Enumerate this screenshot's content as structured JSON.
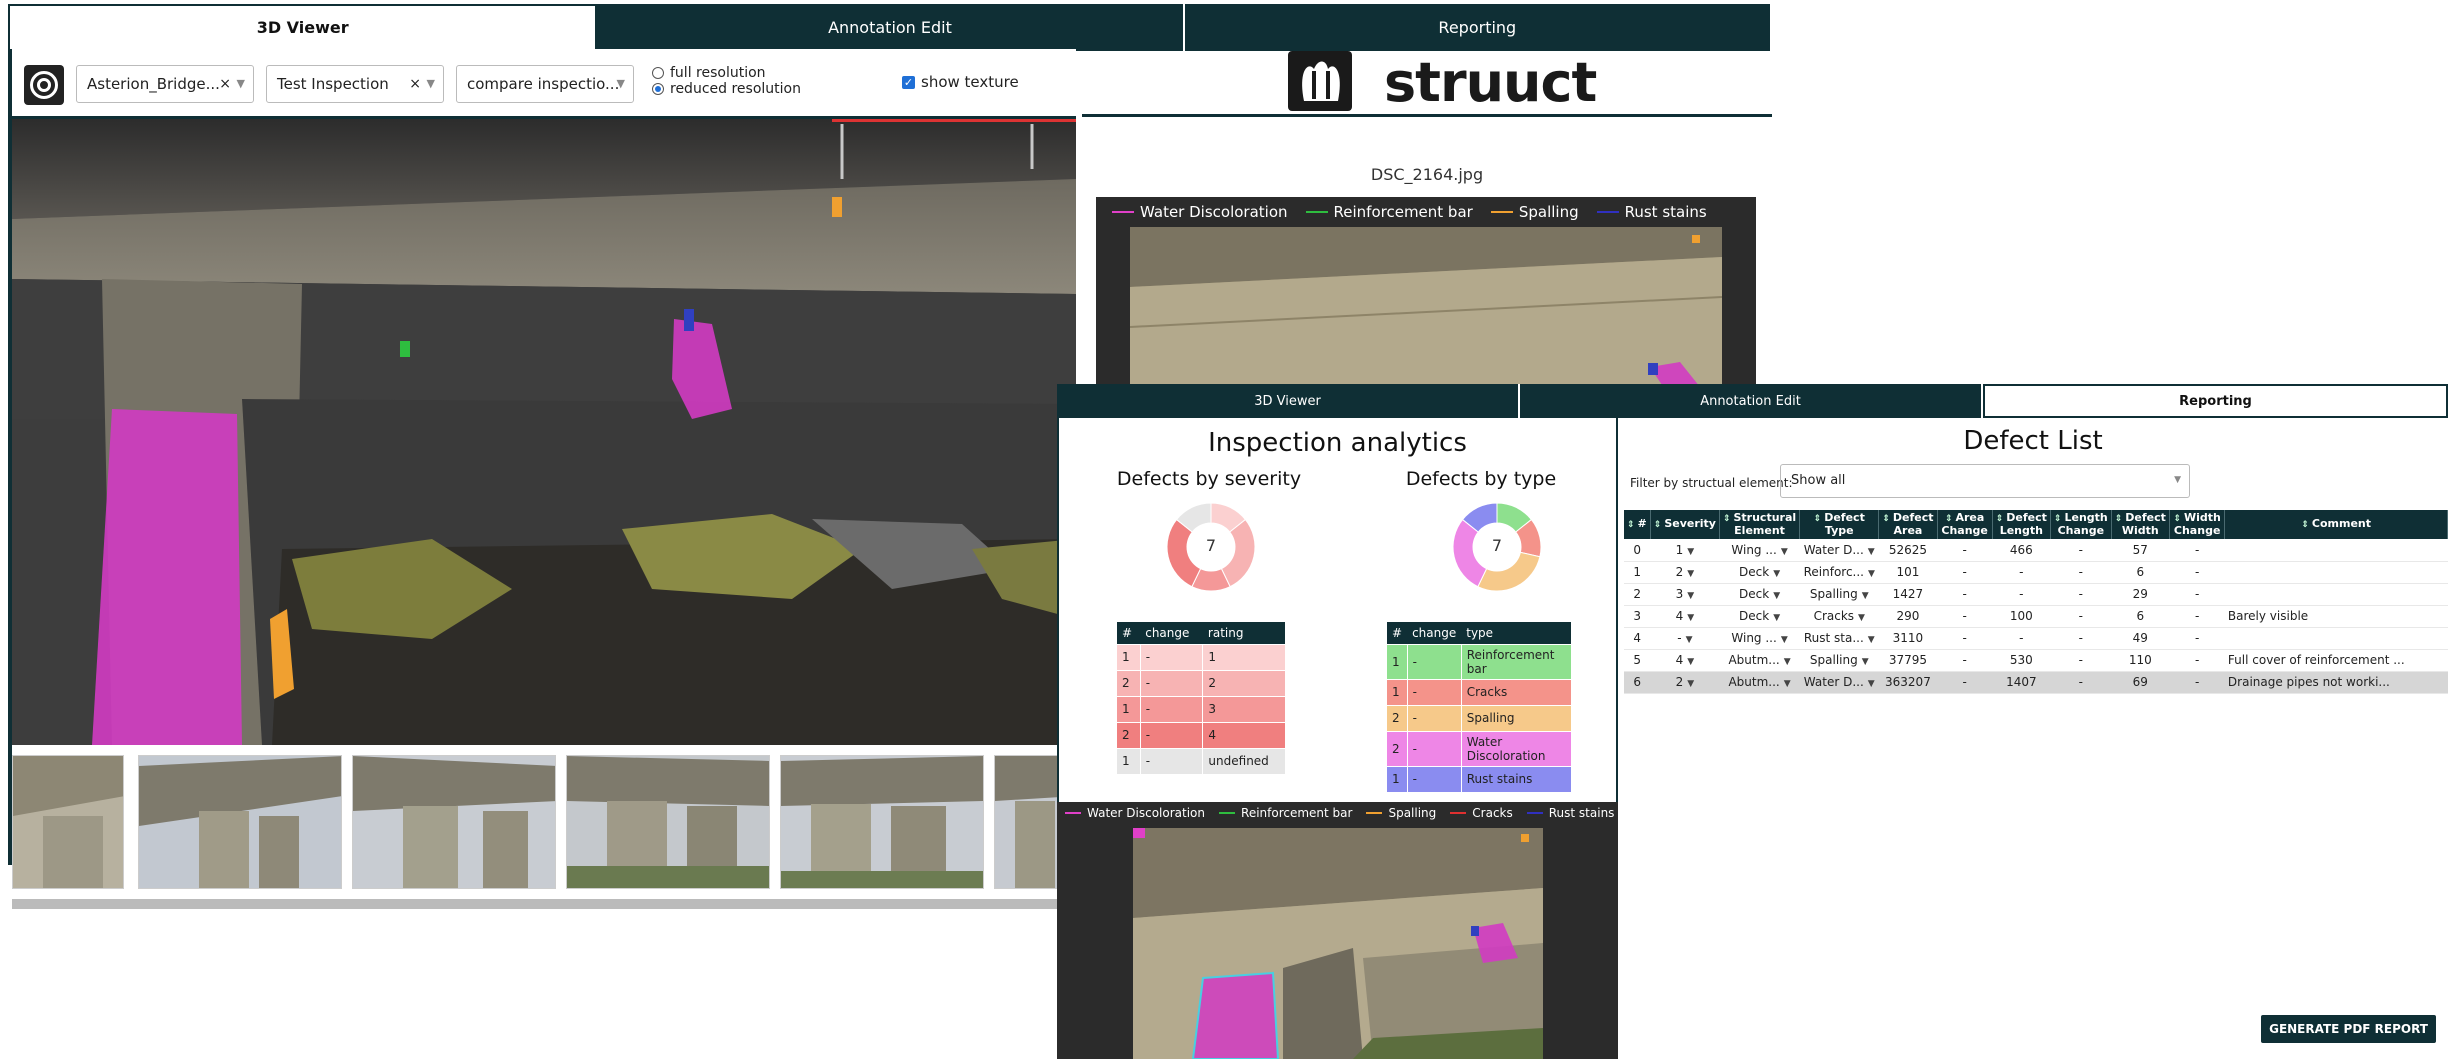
{
  "back_window": {
    "tabs": [
      {
        "label": "3D Viewer",
        "active": true
      },
      {
        "label": "Annotation Edit",
        "active": false
      },
      {
        "label": "Reporting",
        "active": false
      }
    ],
    "toolbar": {
      "structure_select": "Asterion_Bridge...",
      "inspection_select": "Test Inspection",
      "compare_select": "compare inspectio...",
      "resolution_options": [
        "full resolution",
        "reduced resolution"
      ],
      "resolution_selected": "reduced resolution",
      "show_texture_label": "show texture",
      "show_texture_checked": true
    },
    "logo_text": "struuct",
    "image_name": "DSC_2164.jpg",
    "legend": [
      {
        "label": "Water Discoloration",
        "color": "#e040c8"
      },
      {
        "label": "Reinforcement bar",
        "color": "#2ebd3f"
      },
      {
        "label": "Spalling",
        "color": "#f0a030"
      },
      {
        "label": "Rust stains",
        "color": "#3030c0"
      }
    ]
  },
  "front_window": {
    "tabs": [
      {
        "label": "3D Viewer",
        "active": false
      },
      {
        "label": "Annotation Edit",
        "active": false
      },
      {
        "label": "Reporting",
        "active": true
      }
    ],
    "analytics": {
      "title": "Inspection analytics",
      "severity_title": "Defects by severity",
      "type_title": "Defects by type",
      "severity_total": "7",
      "type_total": "7",
      "severity_headers": [
        "#",
        "change",
        "rating"
      ],
      "severity_rows": [
        {
          "count": "1",
          "change": "-",
          "rating": "1",
          "color": "#fbd0d0"
        },
        {
          "count": "2",
          "change": "-",
          "rating": "2",
          "color": "#f7b3b3"
        },
        {
          "count": "1",
          "change": "-",
          "rating": "3",
          "color": "#f49898"
        },
        {
          "count": "2",
          "change": "-",
          "rating": "4",
          "color": "#f07f7f"
        },
        {
          "count": "1",
          "change": "-",
          "rating": "undefined",
          "color": "#e6e6e6"
        }
      ],
      "type_headers": [
        "#",
        "change",
        "type"
      ],
      "type_rows": [
        {
          "count": "1",
          "change": "-",
          "type": "Reinforcement bar",
          "color": "#8ee08e"
        },
        {
          "count": "1",
          "change": "-",
          "type": "Cracks",
          "color": "#f4938a"
        },
        {
          "count": "2",
          "change": "-",
          "type": "Spalling",
          "color": "#f6c98a"
        },
        {
          "count": "2",
          "change": "-",
          "type": "Water Discoloration",
          "color": "#ee86e6"
        },
        {
          "count": "1",
          "change": "-",
          "type": "Rust stains",
          "color": "#8a8cf0"
        }
      ],
      "severity_donut": [
        {
          "value": 1,
          "color": "#fbd0d0"
        },
        {
          "value": 2,
          "color": "#f7b3b3"
        },
        {
          "value": 1,
          "color": "#f49898"
        },
        {
          "value": 2,
          "color": "#f07f7f"
        },
        {
          "value": 1,
          "color": "#e6e6e6"
        }
      ],
      "type_donut": [
        {
          "value": 1,
          "color": "#8ee08e"
        },
        {
          "value": 1,
          "color": "#f4938a"
        },
        {
          "value": 2,
          "color": "#f6c98a"
        },
        {
          "value": 2,
          "color": "#ee86e6"
        },
        {
          "value": 1,
          "color": "#8a8cf0"
        }
      ]
    },
    "bottom_legend": [
      {
        "label": "Water Discoloration",
        "color": "#e040c8"
      },
      {
        "label": "Reinforcement bar",
        "color": "#2ebd3f"
      },
      {
        "label": "Spalling",
        "color": "#f0a030"
      },
      {
        "label": "Cracks",
        "color": "#e03030"
      },
      {
        "label": "Rust stains",
        "color": "#3030c0"
      }
    ],
    "defect_list": {
      "title": "Defect List",
      "filter_label": "Filter by structual element:",
      "filter_value": "Show all",
      "headers": [
        "#",
        "Severity",
        "Structural Element",
        "Defect Type",
        "Defect Area",
        "Area Change",
        "Defect Length",
        "Length Change",
        "Defect Width",
        "Width Change",
        "Comment"
      ],
      "rows": [
        [
          "0",
          "1",
          "Wing ...",
          "Water D...",
          "52625",
          "-",
          "466",
          "-",
          "57",
          "-",
          ""
        ],
        [
          "1",
          "2",
          "Deck",
          "Reinforc...",
          "101",
          "-",
          "-",
          "-",
          "6",
          "-",
          ""
        ],
        [
          "2",
          "3",
          "Deck",
          "Spalling",
          "1427",
          "-",
          "-",
          "-",
          "29",
          "-",
          ""
        ],
        [
          "3",
          "4",
          "Deck",
          "Cracks",
          "290",
          "-",
          "100",
          "-",
          "6",
          "-",
          "Barely visible"
        ],
        [
          "4",
          "-",
          "Wing ...",
          "Rust sta...",
          "3110",
          "-",
          "-",
          "-",
          "49",
          "-",
          ""
        ],
        [
          "5",
          "4",
          "Abutm...",
          "Spalling",
          "37795",
          "-",
          "530",
          "-",
          "110",
          "-",
          "Full cover of reinforcement ..."
        ],
        [
          "6",
          "2",
          "Abutm...",
          "Water D...",
          "363207",
          "-",
          "1407",
          "-",
          "69",
          "-",
          "Drainage pipes not worki..."
        ]
      ],
      "highlighted_row": 6,
      "generate_button": "GENERATE PDF REPORT"
    }
  }
}
